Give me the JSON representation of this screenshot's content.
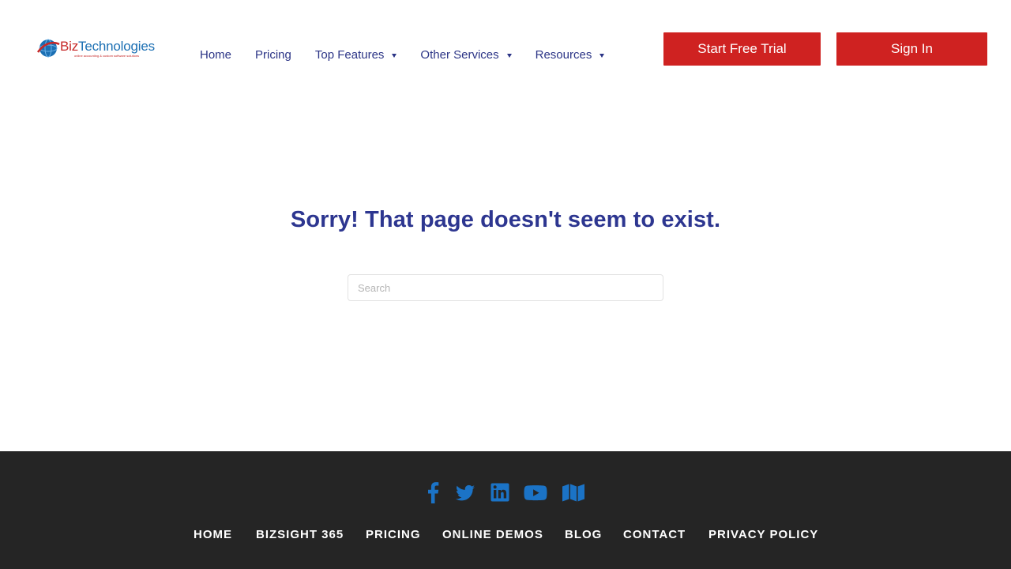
{
  "header": {
    "logo": {
      "name_prefix": "Biz",
      "name_suffix": "Technologies",
      "tagline": "online accounting & custom software solutions"
    },
    "nav": [
      {
        "label": "Home",
        "has_dropdown": false
      },
      {
        "label": "Pricing",
        "has_dropdown": false
      },
      {
        "label": "Top Features",
        "has_dropdown": true
      },
      {
        "label": "Other Services",
        "has_dropdown": true
      },
      {
        "label": "Resources",
        "has_dropdown": true
      }
    ],
    "trial_label": "Start Free Trial",
    "signin_label": "Sign In"
  },
  "main": {
    "title": "Sorry! That page doesn't seem to exist.",
    "search": {
      "placeholder": "Search",
      "value": ""
    }
  },
  "footer": {
    "social": [
      "facebook-icon",
      "twitter-icon",
      "linkedin-icon",
      "youtube-icon",
      "map-icon"
    ],
    "links": [
      "HOME",
      "BIZSIGHT 365",
      "PRICING",
      "ONLINE DEMOS",
      "BLOG",
      "CONTACT",
      "PRIVACY POLICY"
    ]
  },
  "colors": {
    "brand_navy": "#2d3690",
    "button_red": "#cf2221",
    "footer_bg": "#252525",
    "social_blue": "#1b73c6"
  }
}
